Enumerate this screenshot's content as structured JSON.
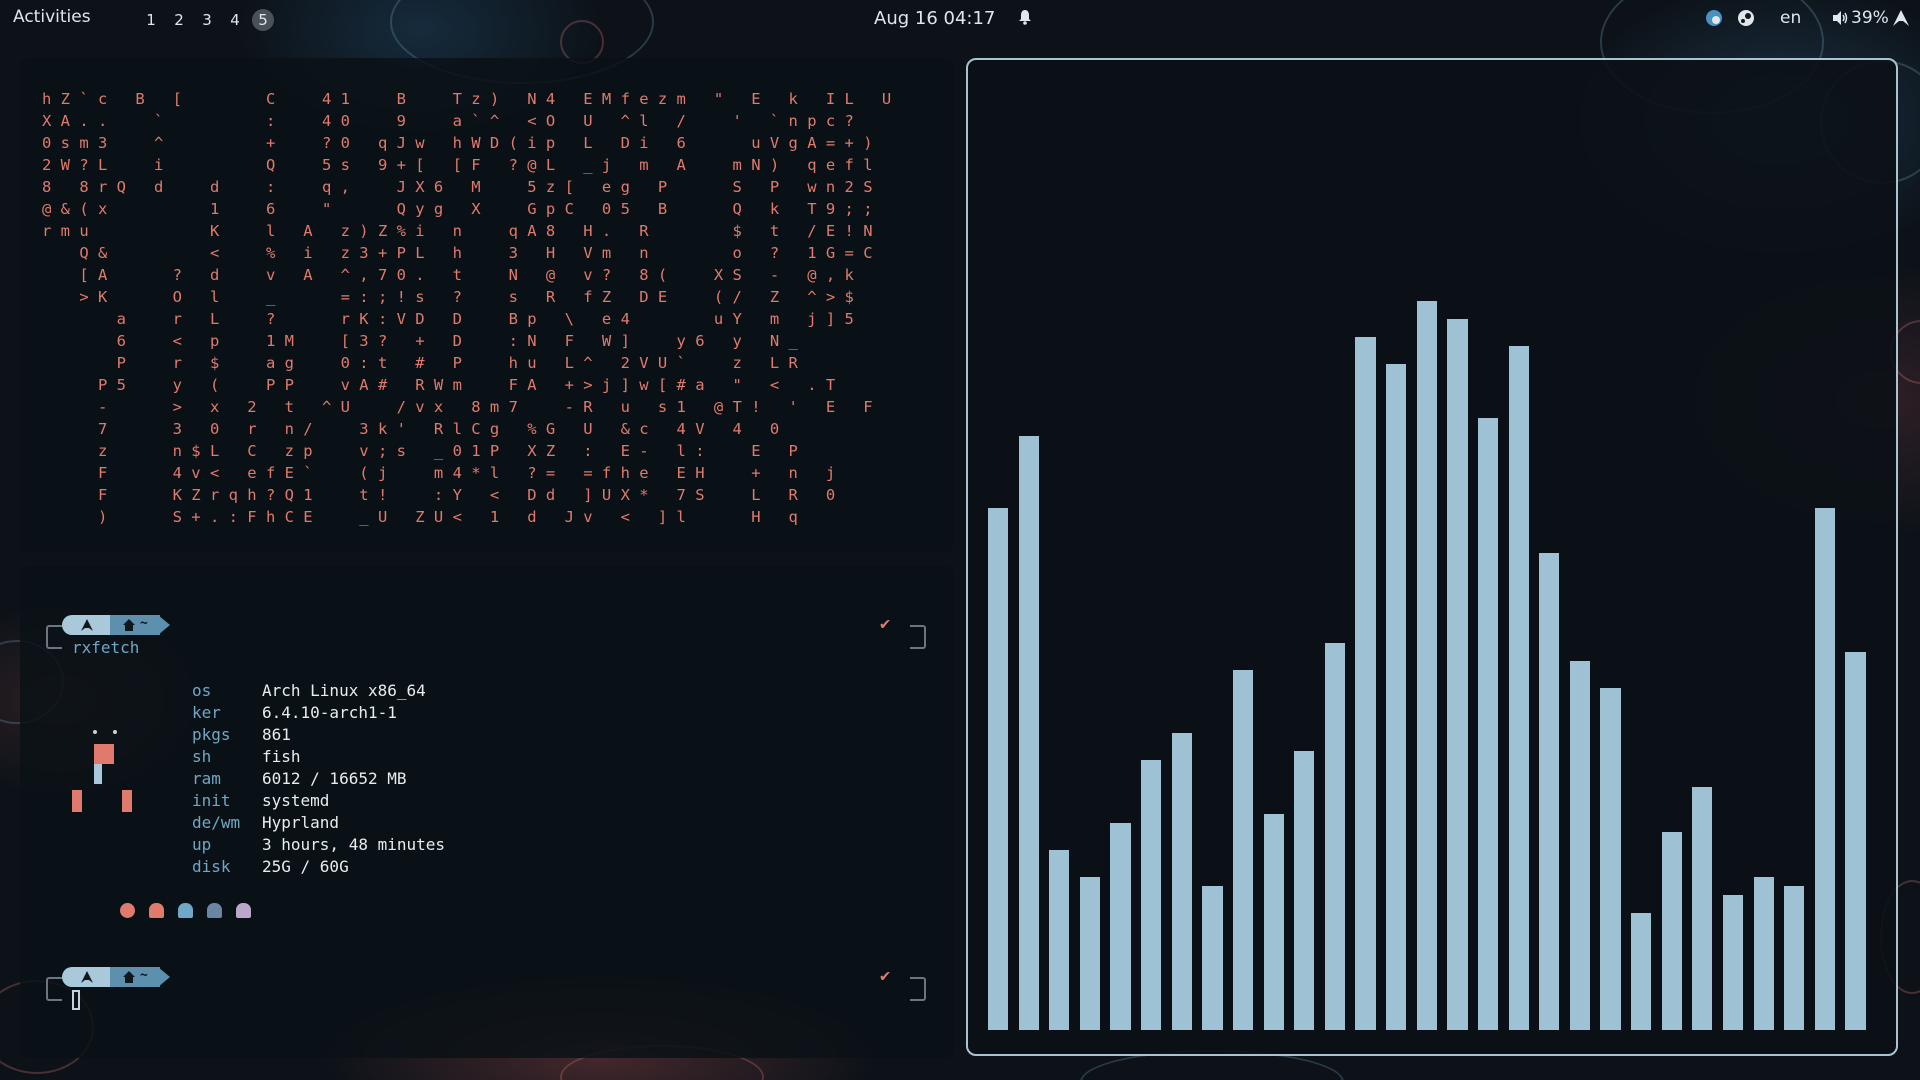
{
  "topbar": {
    "activities": "Activities",
    "workspaces": [
      "1",
      "2",
      "3",
      "4",
      "5"
    ],
    "active_workspace": "5",
    "clock": "Aug 16 04:17",
    "language": "en",
    "battery": "39%"
  },
  "matrix_rows": [
    "hZ`c B [    C  41  B  Tz) N4 EMfezm \" E k IL U",
    "XA..  `     :  40  9  a`^ <O U ^l /  ' `npc?",
    "0sm3  ^     +  ?0 qJw hWD(ip L Di 6   uVgA=+)",
    "2W?L  i     Q  5s 9+[ [F ?@L _j m A  mN) qefl",
    "8 8rQ d  d  :  q,  JX6 M  5z[ eg P   S P wn2S",
    "@&(x     1  6  \"   Qyg X  GpC 05 B   Q k T9;;",
    "rmu      K  l A z)Z%i n  qA8 H. R    $ t /E!N",
    "  Q&     <  % i z3+PL h  3 H Vm n    o ? 1G=C",
    "  [A   ? d  v A ^,70. t  N @ v? 8(  XS - @,k",
    "  >K   O l  _   =:;!s ?  s R fZ DE  (/ Z ^>$",
    "    a  r L  ?   rK:VD D  Bp \\ e4    uY m j]5",
    "    6  < p  1M  [3? + D  :N F W]  y6 y N_",
    "    P  r $  ag  0:t # P  hu L^ 2VU`  z LR",
    "   P5  y (  PP  vA# RWm  FA +>j]w[#a \" < .T",
    "   -   > x 2 t ^U  /vx 8m7  -R u s1 @T! ' E F",
    "   7   3 0 r n/  3k' RlCg %G U &c 4V 4 0",
    "   z   n$L C zp  v;s _01P XZ : E- l:  E P",
    "   F   4v< efE`  (j  m4*l ?= =fhe EH  + n j",
    "   F   KZrqh?Q1  t!  :Y < Dd ]UX* 7S  L R 0",
    "   )   S+.:FhCE  _U ZU< 1 d Jv < ]l   H q"
  ],
  "terminal": {
    "prompt_home": "~",
    "command": "rxfetch",
    "fetch": [
      {
        "key": "os",
        "value": "Arch Linux x86_64"
      },
      {
        "key": "ker",
        "value": "6.4.10-arch1-1"
      },
      {
        "key": "pkgs",
        "value": "861"
      },
      {
        "key": "sh",
        "value": "fish"
      },
      {
        "key": "ram",
        "value": "6012 / 16652 MB"
      },
      {
        "key": "init",
        "value": "systemd"
      },
      {
        "key": "de/wm",
        "value": "Hyprland"
      },
      {
        "key": "up",
        "value": "3 hours, 48 minutes"
      },
      {
        "key": "disk",
        "value": "25G / 60G"
      }
    ],
    "ghost_colors": [
      "#e07a6c",
      "#e07a6c",
      "#6fa7c6",
      "#6a86a0",
      "#b9a9c8"
    ]
  },
  "visualizer": {
    "levels": [
      0.58,
      0.66,
      0.2,
      0.17,
      0.23,
      0.3,
      0.33,
      0.16,
      0.4,
      0.24,
      0.31,
      0.43,
      0.77,
      0.74,
      0.81,
      0.79,
      0.68,
      0.76,
      0.53,
      0.41,
      0.38,
      0.13,
      0.22,
      0.27,
      0.15,
      0.17,
      0.16,
      0.58,
      0.42
    ],
    "color": "#9ec2d4"
  },
  "colors": {
    "accent_red": "#e07a6c",
    "accent_blue": "#6fa7c6",
    "frame": "#a9c3d1"
  }
}
